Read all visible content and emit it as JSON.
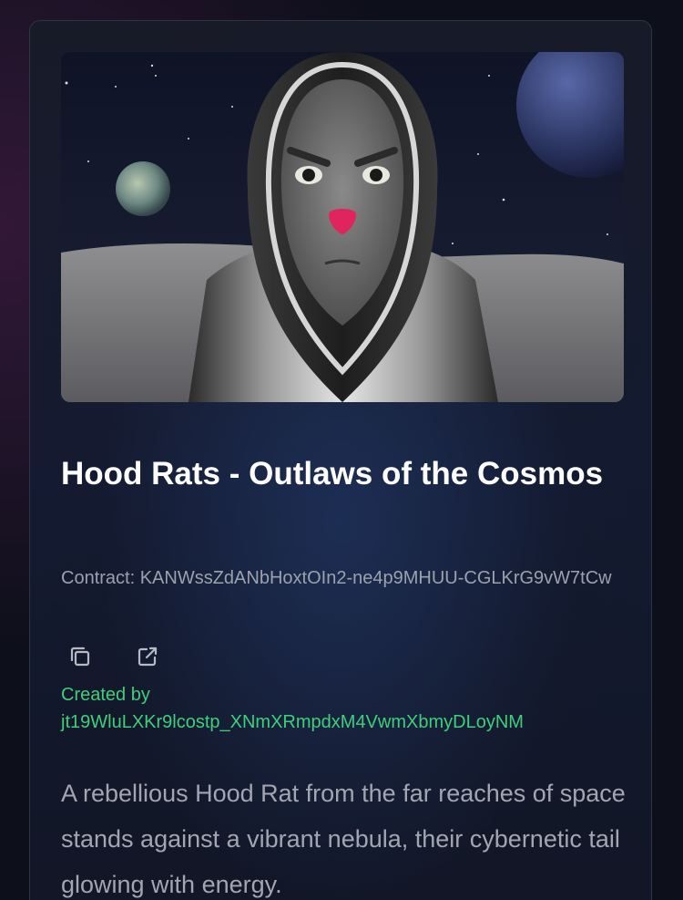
{
  "nft": {
    "title": "Hood Rats - Outlaws of the Cosmos",
    "contract_label": "Contract:",
    "contract_id": "KANWssZdANbHoxtOIn2-ne4p9MHUU-CGLKrG9vW7tCw",
    "created_by_label": "Created by",
    "creator": "jt19WluLXKr9lcostp_XNmXRmpdxM4VwmXbmyDLoyNM",
    "description": "A rebellious Hood Rat from the far reaches of space stands against a vibrant nebula, their cybernetic tail glowing with energy."
  },
  "actions": {
    "copy_icon": "copy-icon",
    "external_link_icon": "external-link-icon"
  },
  "colors": {
    "accent_green": "#3ecf7a",
    "title_white": "#ffffff",
    "muted_text": "#9ba1ad",
    "nose_pink": "#e0245e"
  }
}
